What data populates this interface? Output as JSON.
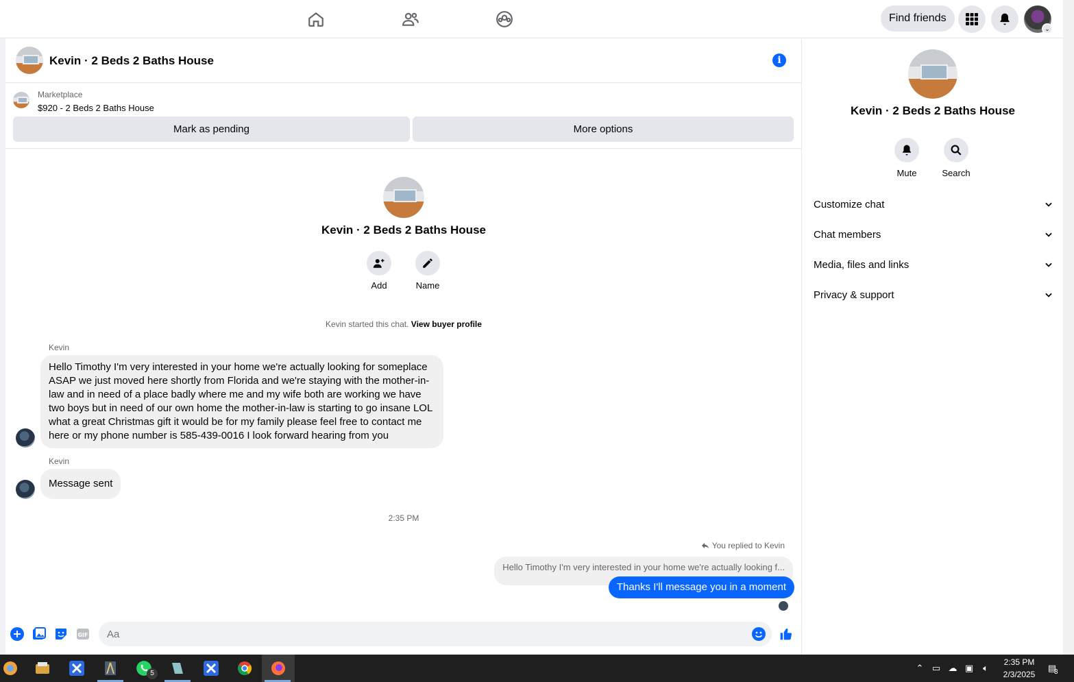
{
  "topnav": {
    "find_friends_label": "Find friends",
    "icons": [
      "home-icon",
      "friends-icon",
      "groups-icon",
      "menu-grid-icon",
      "notifications-icon"
    ]
  },
  "chat": {
    "title": "Kevin · 2 Beds 2 Baths House",
    "marketplace_label": "Marketplace",
    "listing": "$920 - 2 Beds 2 Baths House",
    "mark_pending_label": "Mark as pending",
    "more_options_label": "More options",
    "intro_name": "Kevin · 2 Beds 2 Baths House",
    "add_label": "Add",
    "name_label": "Name",
    "started_text": "Kevin started this chat.",
    "view_buyer_profile": "View buyer profile",
    "messages": [
      {
        "sender": "Kevin",
        "lines": [
          "Hello Timothy I'm very interested  in your home we're actually looking for someplace",
          "ASAP we just moved here shortly from Florida and we're staying with the mother-in-",
          "law and in need of a place badly where me and my wife both are working we have",
          "two boys but in need of our own home the mother-in-law is starting to go insane LOL",
          "what a great Christmas gift it would be for my family please feel free to contact me",
          "here or my phone number is 585-439-0016 I look forward hearing from you"
        ]
      },
      {
        "sender": "Kevin",
        "text": "Message sent"
      }
    ],
    "timestamp": "2:35 PM",
    "replied_text": "You replied to Kevin",
    "quoted_text": "Hello Timothy I'm very interested  in your home we're actually looking f...",
    "outgoing_text": "Thanks I'll message you in a moment",
    "composer_placeholder": "Aa"
  },
  "details": {
    "name": "Kevin · 2 Beds 2 Baths House",
    "mute_label": "Mute",
    "search_label": "Search",
    "sections": [
      "Customize chat",
      "Chat members",
      "Media, files and links",
      "Privacy & support"
    ]
  },
  "taskbar": {
    "time": "2:35 PM",
    "date": "2/3/2025",
    "whatsapp_badge": "5",
    "notification_badge": "3"
  },
  "colors": {
    "accent": "#0866ff",
    "bubble_in": "#f0f0f0",
    "button_bg": "#e4e6eb"
  }
}
